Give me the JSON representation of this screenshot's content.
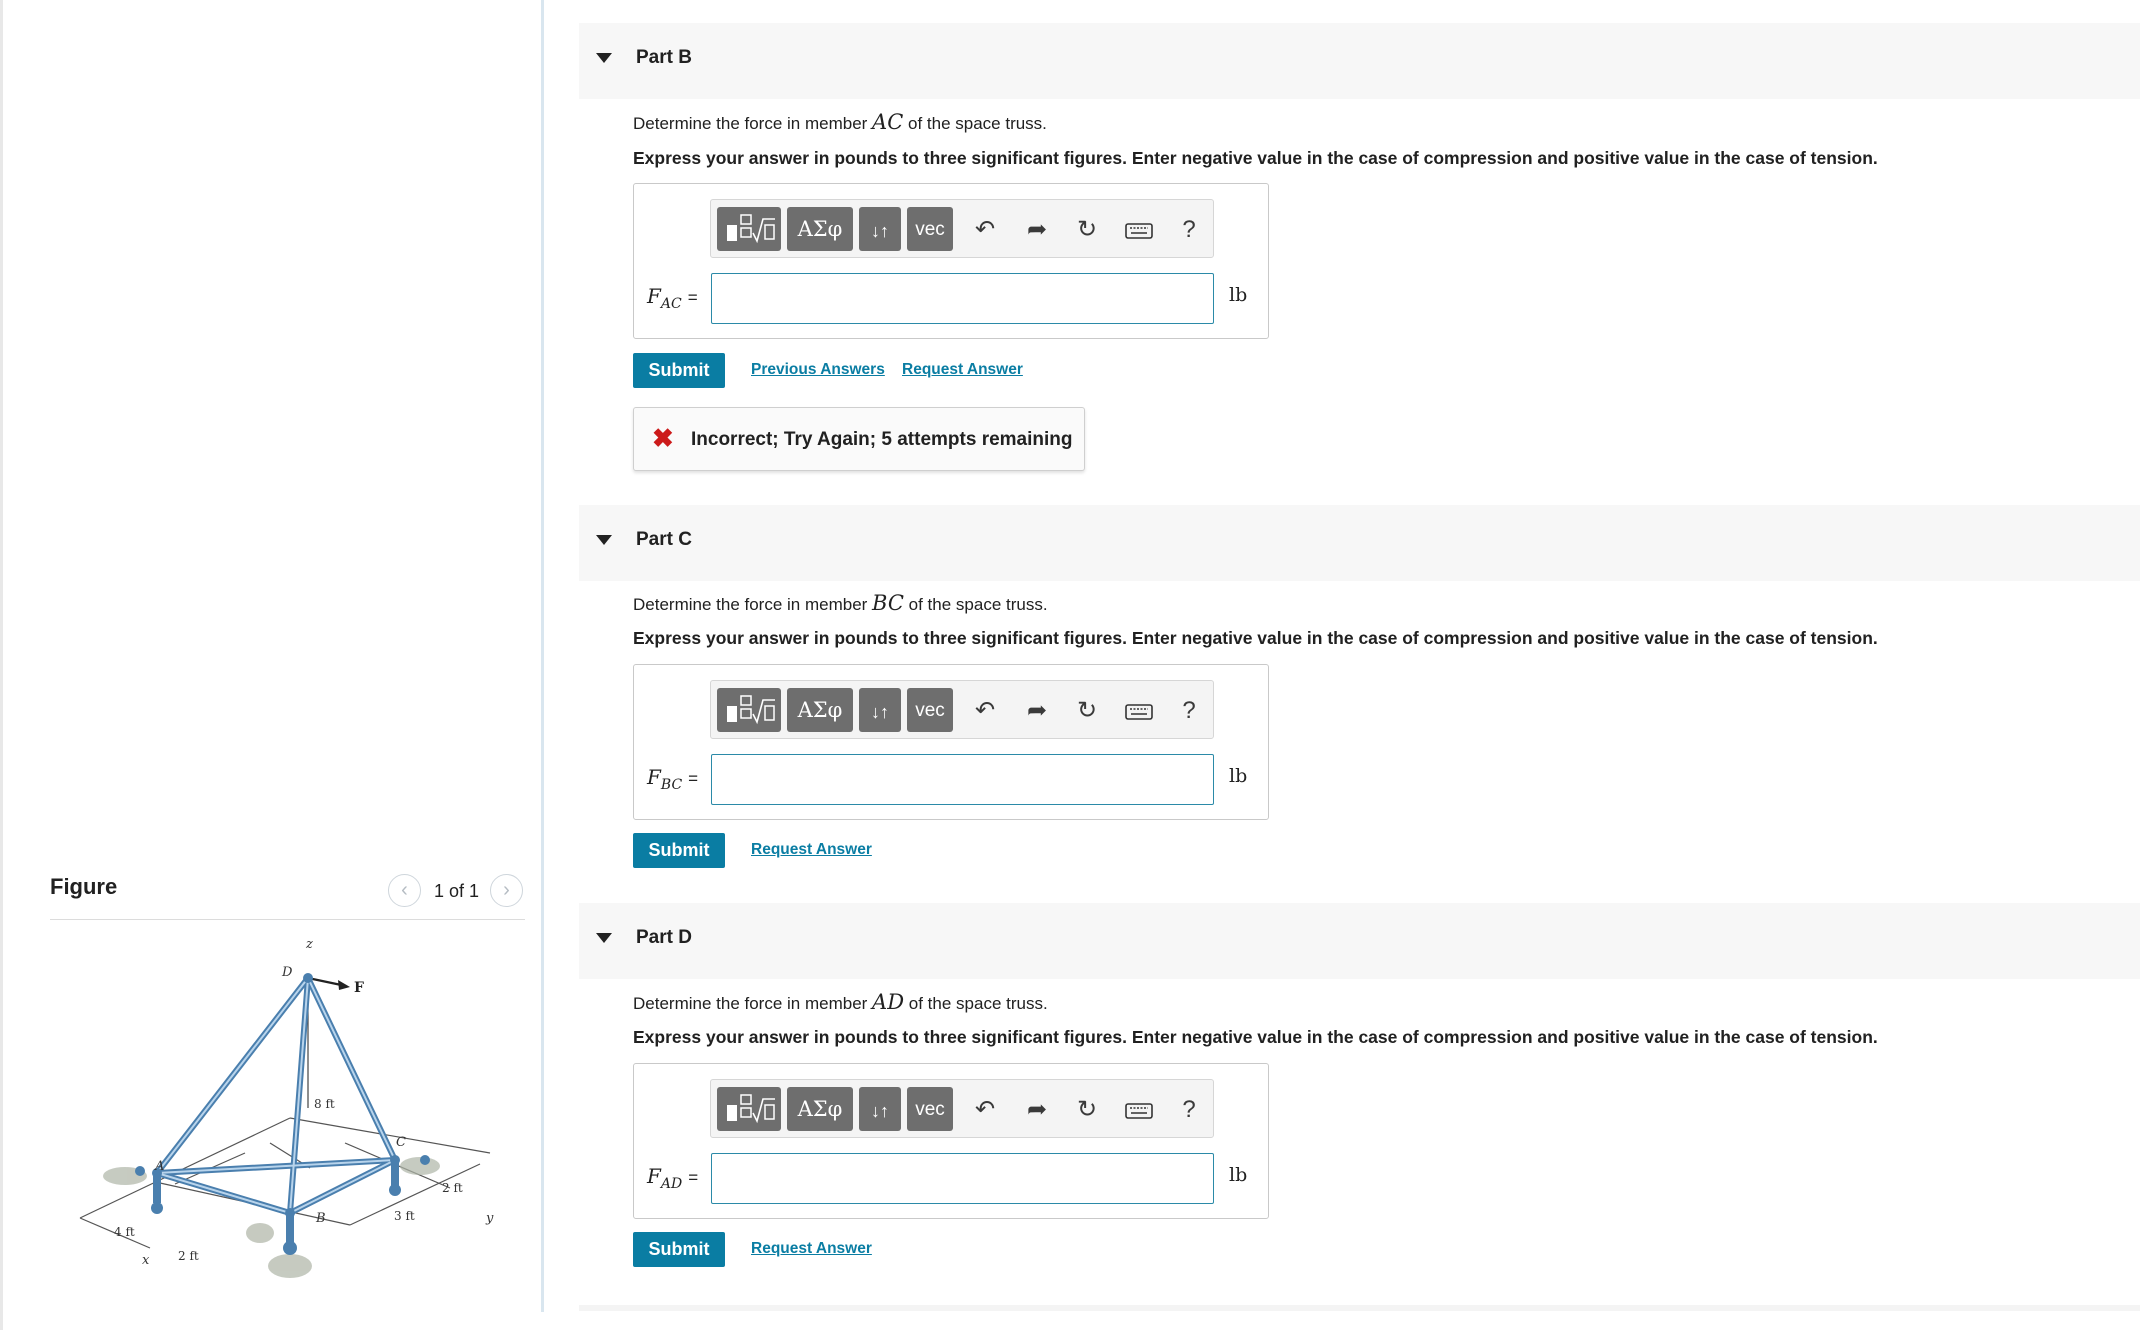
{
  "figure": {
    "title": "Figure",
    "pager": "1 of 1",
    "prev_icon": "chevron-left-icon",
    "next_icon": "chevron-right-icon",
    "labels": {
      "z": "z",
      "D": "D",
      "F": "F",
      "A": "A",
      "B": "B",
      "C": "C",
      "x": "x",
      "y": "y",
      "dim_8ft": "8 ft",
      "dim_4ft": "4 ft",
      "dim_2ft_x": "2 ft",
      "dim_2ft_y": "2 ft",
      "dim_3ft": "3 ft"
    }
  },
  "toolbar": {
    "template_icon": "fraction-sqrt-template-icon",
    "greek_label": "ΑΣφ",
    "arrows_label": "↓↑",
    "vec_label": "vec",
    "undo_icon": "undo-icon",
    "redo_icon": "redo-icon",
    "reset_icon": "reset-icon",
    "keyboard_icon": "keyboard-icon",
    "help_label": "?"
  },
  "parts": [
    {
      "title": "Part B",
      "prompt_pre": "Determine the force in member ",
      "member": "AC",
      "prompt_post": " of the space truss.",
      "instruction": "Express your answer in pounds to three significant figures. Enter negative value in the case of compression and positive value in the case of tension.",
      "var_main": "F",
      "var_sub": "AC",
      "equals": "=",
      "input_value": "",
      "unit": "lb",
      "submit": "Submit",
      "previous_answers": "Previous Answers",
      "request_answer": "Request Answer",
      "feedback": "Incorrect; Try Again; 5 attempts remaining",
      "feedback_icon": "error-x-icon"
    },
    {
      "title": "Part C",
      "prompt_pre": "Determine the force in member ",
      "member": "BC",
      "prompt_post": " of the space truss.",
      "instruction": "Express your answer in pounds to three significant figures. Enter negative value in the case of compression and positive value in the case of tension.",
      "var_main": "F",
      "var_sub": "BC",
      "equals": "=",
      "input_value": "",
      "unit": "lb",
      "submit": "Submit",
      "request_answer": "Request Answer"
    },
    {
      "title": "Part D",
      "prompt_pre": "Determine the force in member ",
      "member": "AD",
      "prompt_post": " of the space truss.",
      "instruction": "Express your answer in pounds to three significant figures. Enter negative value in the case of compression and positive value in the case of tension.",
      "var_main": "F",
      "var_sub": "AD",
      "equals": "=",
      "input_value": "",
      "unit": "lb",
      "submit": "Submit",
      "request_answer": "Request Answer"
    }
  ]
}
